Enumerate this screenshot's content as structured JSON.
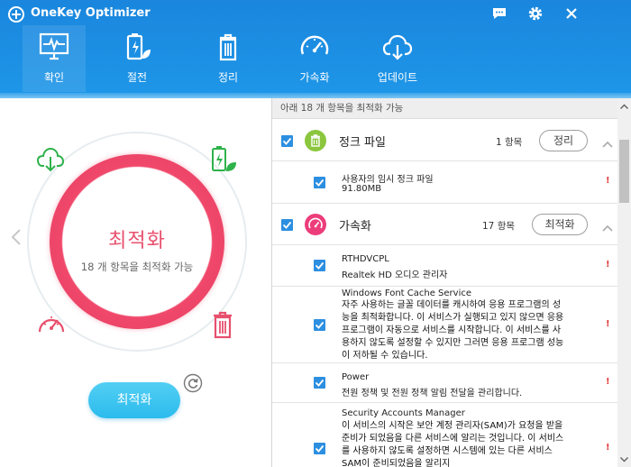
{
  "app": {
    "title": "OneKey Optimizer",
    "colors": {
      "header": "#1a86dd",
      "accent_red": "#e8506e",
      "button": "#2cbbed",
      "checkbox": "#2d8fe0",
      "warn": "#e03c3c"
    }
  },
  "titlebar_icons": [
    "chat-icon",
    "gear-icon",
    "close-icon"
  ],
  "nav": {
    "tabs": [
      {
        "label": "확인",
        "icon": "monitor-pulse-icon",
        "active": true
      },
      {
        "label": "절전",
        "icon": "battery-leaf-icon",
        "active": false
      },
      {
        "label": "정리",
        "icon": "trash-icon",
        "active": false
      },
      {
        "label": "가속화",
        "icon": "speedometer-icon",
        "active": false
      },
      {
        "label": "업데이트",
        "icon": "cloud-download-icon",
        "active": false
      }
    ]
  },
  "left": {
    "center_title": "최적화",
    "center_subtitle": "18 개 항목을 최적화 가능",
    "main_button": "최적화"
  },
  "right": {
    "summary": "아래 18 개 항목을 최적화 가능",
    "categories": [
      {
        "name": "정크 파일",
        "count": "1 항목",
        "button": "정리",
        "icon": "trash-icon"
      },
      {
        "name": "가속화",
        "count": "17 항목",
        "button": "최적화",
        "icon": "speedometer-icon"
      }
    ],
    "junk_items": [
      {
        "title": "사용자의 임시 정크 파일",
        "detail": "91.80MB",
        "warn": "!"
      }
    ],
    "speed_items": [
      {
        "title": "RTHDVCPL",
        "detail": "Realtek HD 오디오 관리자",
        "warn": "!"
      },
      {
        "title": "Windows Font Cache Service",
        "detail": "자주 사용하는 글꼴 데이터를 캐시하여 응용 프로그램의 성능을 최적화합니다. 이 서비스가 실행되고 있지 않으면 응용 프로그램이 자동으로 서비스를 시작합니다. 이 서비스를 사용하지 않도록 설정할 수 있지만 그러면 응용 프로그램 성능이 저하될 수 있습니다.",
        "warn": "!"
      },
      {
        "title": "Power",
        "detail": "전원 정책 및 전원 정책 알림 전달을 관리합니다.",
        "warn": "!"
      },
      {
        "title": "Security Accounts Manager",
        "detail": "이 서비스의 시작은 보안 계정 관리자(SAM)가 요청을 받을 준비가 되었음을 다른 서비스에 알리는 것입니다. 이 서비스를 사용하지 않도록 설정하면 시스템에 있는 다른 서비스 SAM이 준비되었음을 알리지",
        "warn": "!"
      }
    ]
  }
}
